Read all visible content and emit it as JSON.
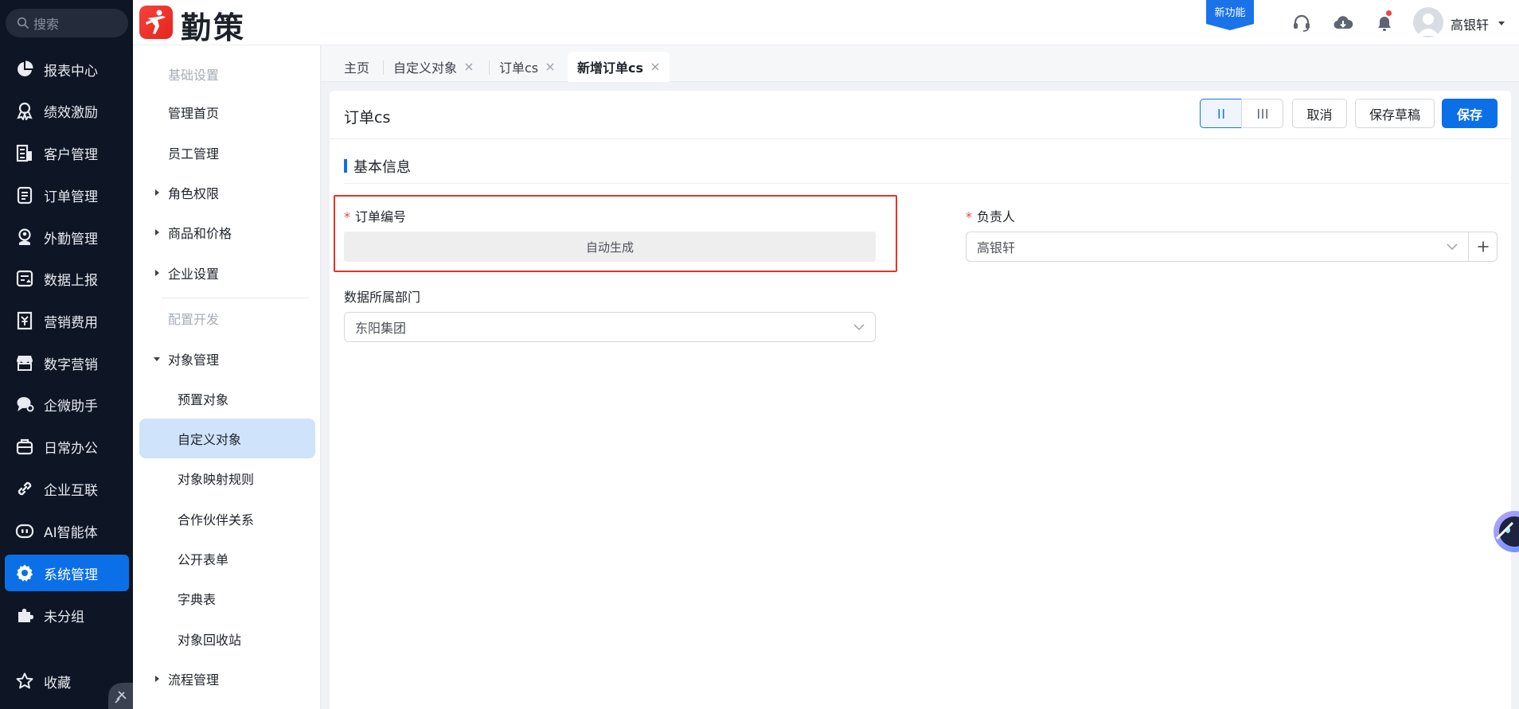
{
  "search": {
    "placeholder": "搜索"
  },
  "sidebar": {
    "items": [
      {
        "label": "报表中心",
        "icon": "pie-chart-icon"
      },
      {
        "label": "绩效激励",
        "icon": "award-icon"
      },
      {
        "label": "客户管理",
        "icon": "building-icon"
      },
      {
        "label": "订单管理",
        "icon": "clipboard-icon"
      },
      {
        "label": "外勤管理",
        "icon": "location-person-icon"
      },
      {
        "label": "数据上报",
        "icon": "report-upload-icon"
      },
      {
        "label": "营销费用",
        "icon": "expense-icon"
      },
      {
        "label": "数字营销",
        "icon": "storefront-icon"
      },
      {
        "label": "企微助手",
        "icon": "chat-bubble-icon"
      },
      {
        "label": "日常办公",
        "icon": "briefcase-icon"
      },
      {
        "label": "企业互联",
        "icon": "link-icon"
      },
      {
        "label": "AI智能体",
        "icon": "robot-icon"
      },
      {
        "label": "系统管理",
        "icon": "gear-icon",
        "active": true
      },
      {
        "label": "未分组",
        "icon": "puzzle-icon"
      },
      {
        "label": "收藏",
        "icon": "star-icon"
      }
    ]
  },
  "header": {
    "logo_text": "勤策",
    "new_feature": "新功能",
    "user_name": "高银轩"
  },
  "submenu": {
    "items": [
      {
        "label": "基础设置",
        "type": "group"
      },
      {
        "label": "管理首页",
        "type": "item"
      },
      {
        "label": "员工管理",
        "type": "item"
      },
      {
        "label": "角色权限",
        "type": "collapsed"
      },
      {
        "label": "商品和价格",
        "type": "collapsed"
      },
      {
        "label": "企业设置",
        "type": "collapsed"
      },
      {
        "label": "配置开发",
        "type": "group"
      },
      {
        "label": "对象管理",
        "type": "expanded"
      },
      {
        "label": "预置对象",
        "type": "child"
      },
      {
        "label": "自定义对象",
        "type": "child",
        "active": true
      },
      {
        "label": "对象映射规则",
        "type": "child"
      },
      {
        "label": "合作伙伴关系",
        "type": "child"
      },
      {
        "label": "公开表单",
        "type": "child"
      },
      {
        "label": "字典表",
        "type": "child"
      },
      {
        "label": "对象回收站",
        "type": "child"
      },
      {
        "label": "流程管理",
        "type": "collapsed"
      }
    ]
  },
  "tabs": [
    {
      "label": "主页",
      "closable": false
    },
    {
      "label": "自定义对象",
      "closable": true
    },
    {
      "label": "订单cs",
      "closable": true
    },
    {
      "label": "新增订单cs",
      "closable": true,
      "active": true
    }
  ],
  "form": {
    "title": "订单cs",
    "buttons": {
      "cancel": "取消",
      "save_draft": "保存草稿",
      "save": "保存"
    },
    "section_title": "基本信息",
    "order_no": {
      "label": "订单编号",
      "value": "自动生成",
      "required": true
    },
    "owner": {
      "label": "负责人",
      "value": "高银轩",
      "required": true
    },
    "department": {
      "label": "数据所属部门",
      "value": "东阳集团",
      "required": false
    }
  },
  "colors": {
    "accent": "#0b6fe8",
    "sidebar_bg": "#0e1524",
    "highlight": "#e5342a"
  }
}
